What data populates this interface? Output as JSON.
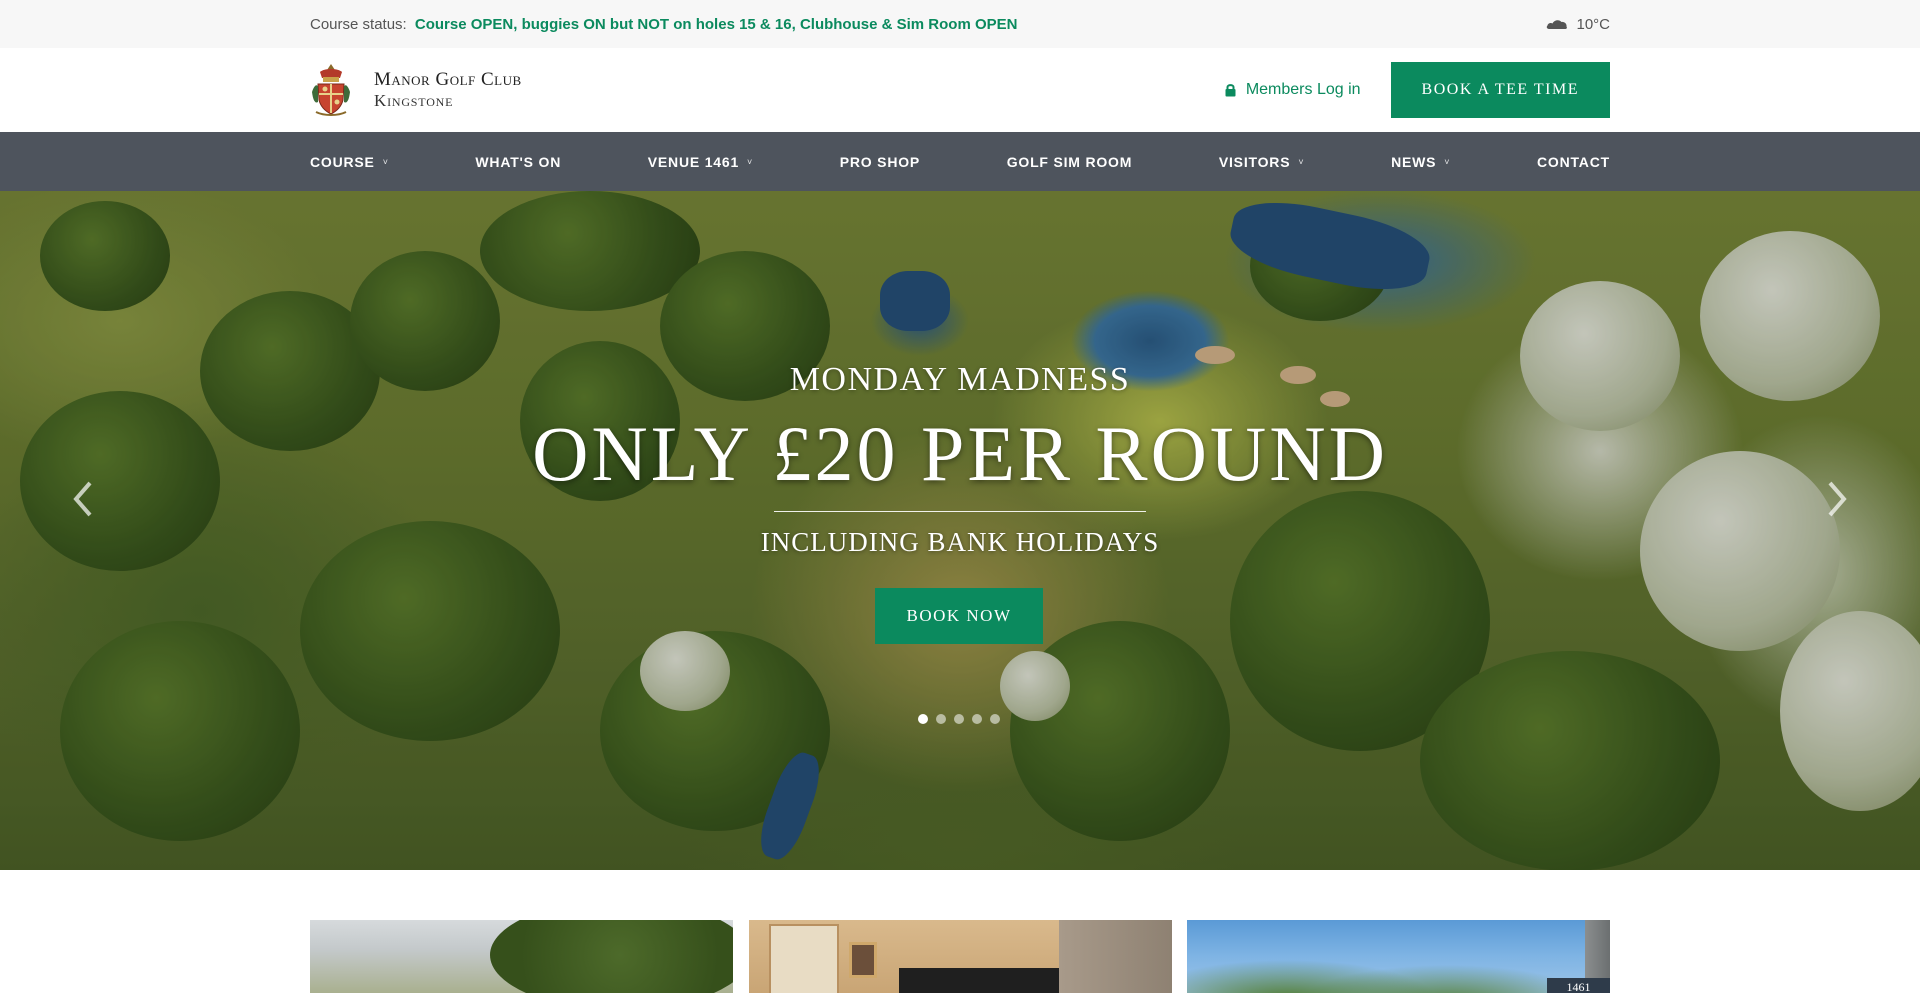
{
  "status_bar": {
    "label": "Course status:",
    "text": "Course OPEN, buggies ON but NOT on holes 15 & 16, Clubhouse & Sim Room OPEN",
    "weather_icon": "cloud-icon",
    "temperature": "10°C"
  },
  "header": {
    "club_name": "Manor Golf Club",
    "club_location": "Kingstone",
    "login_label": "Members Log in",
    "login_icon": "lock-icon",
    "tee_button": "Book a Tee Time"
  },
  "nav": {
    "items": [
      {
        "label": "Course",
        "dropdown": true
      },
      {
        "label": "What's On",
        "dropdown": false
      },
      {
        "label": "Venue 1461",
        "dropdown": true
      },
      {
        "label": "Pro Shop",
        "dropdown": false
      },
      {
        "label": "Golf Sim Room",
        "dropdown": false
      },
      {
        "label": "Visitors",
        "dropdown": true
      },
      {
        "label": "News",
        "dropdown": true
      },
      {
        "label": "Contact",
        "dropdown": false
      }
    ],
    "chevron": "˅"
  },
  "hero": {
    "kicker": "Monday Madness",
    "title": "Only £20 per round",
    "subtitle": "Including Bank Holidays",
    "button": "Book Now",
    "slide_count": 5,
    "active_slide": 1
  },
  "cards": {
    "card_3_sign": "1461"
  },
  "colors": {
    "brand_green": "#0b8a5e",
    "nav_bg": "#4e545d",
    "status_bg": "#f7f7f7"
  }
}
